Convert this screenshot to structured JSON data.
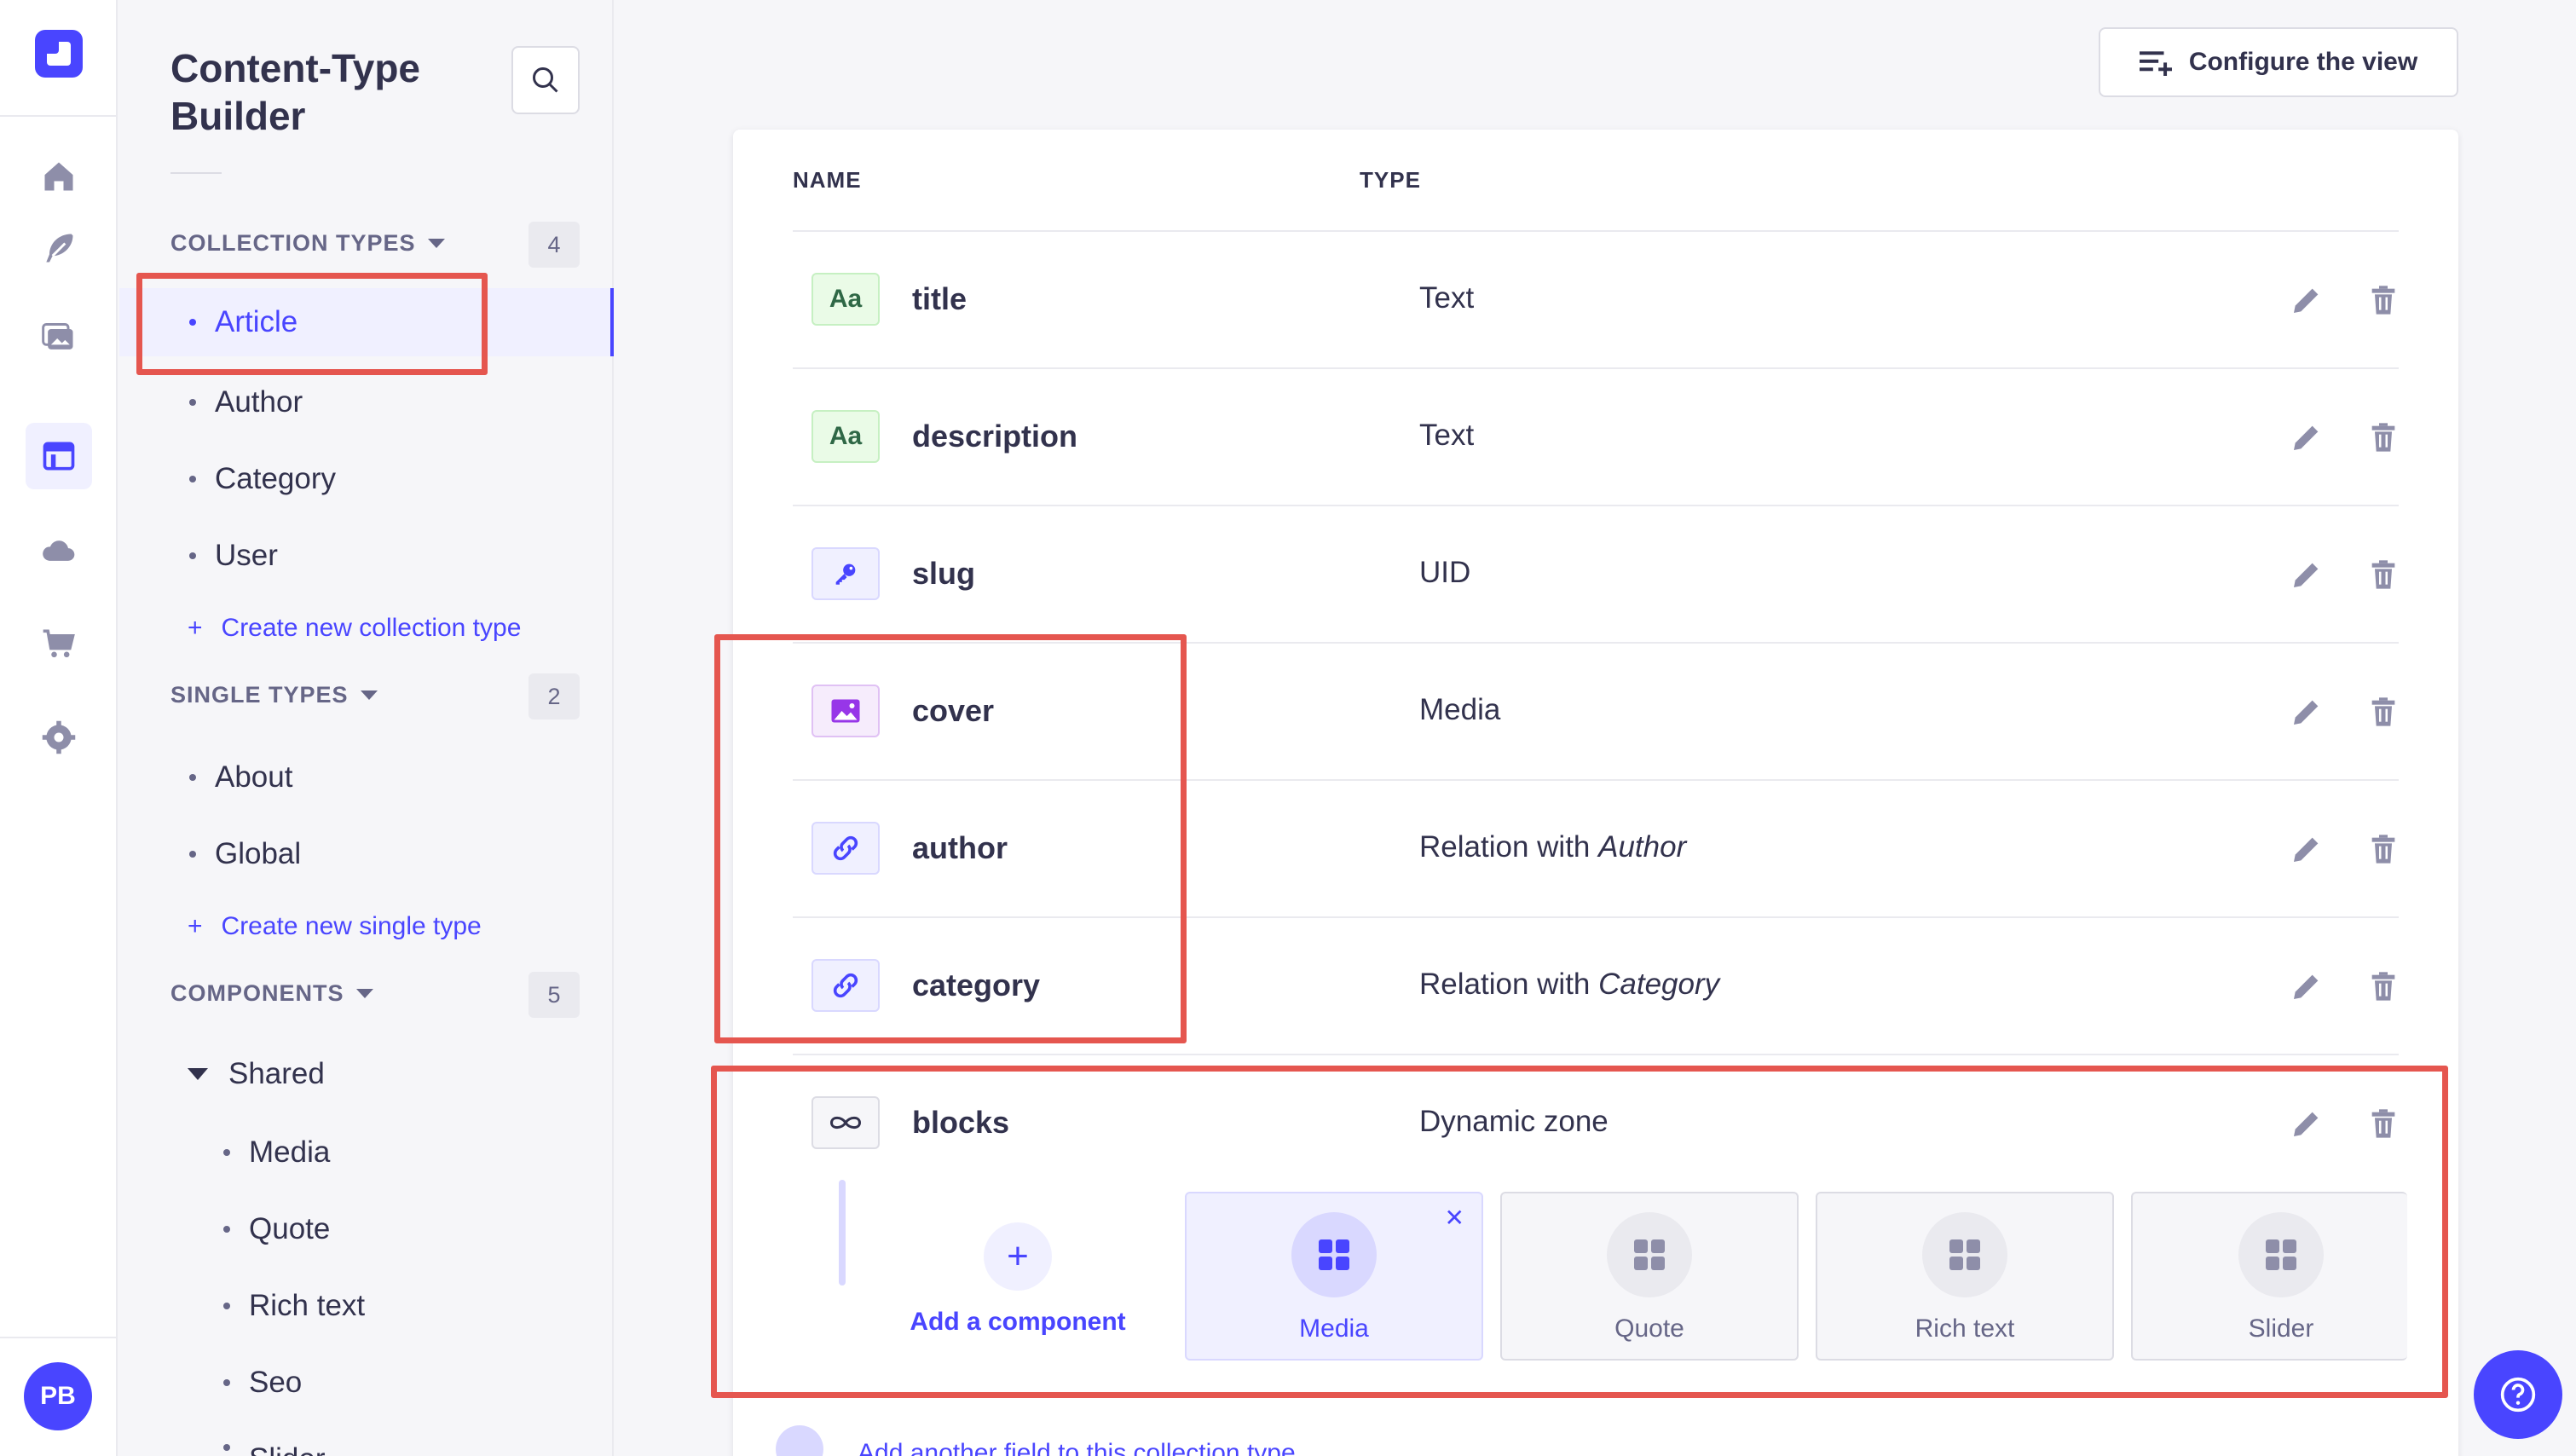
{
  "app": {
    "avatar_initials": "PB"
  },
  "subnav": {
    "title": "Content-Type Builder",
    "collection_types": {
      "label": "COLLECTION TYPES",
      "count": "4",
      "items": [
        "Article",
        "Author",
        "Category",
        "User"
      ],
      "active": "Article",
      "create_label": "Create new collection type"
    },
    "single_types": {
      "label": "SINGLE TYPES",
      "count": "2",
      "items": [
        "About",
        "Global"
      ],
      "create_label": "Create new single type"
    },
    "components": {
      "label": "COMPONENTS",
      "count": "5",
      "group": "Shared",
      "items": [
        "Media",
        "Quote",
        "Rich text",
        "Seo",
        "Slider"
      ]
    }
  },
  "toolbar": {
    "configure_label": "Configure the view"
  },
  "table": {
    "headers": {
      "name": "NAME",
      "type": "TYPE"
    },
    "rows": [
      {
        "icon": "text-icon",
        "icon_label": "Aa",
        "name": "title",
        "type": "Text"
      },
      {
        "icon": "text-icon",
        "icon_label": "Aa",
        "name": "description",
        "type": "Text"
      },
      {
        "icon": "key-icon",
        "name": "slug",
        "type": "UID"
      },
      {
        "icon": "image-icon",
        "name": "cover",
        "type": "Media"
      },
      {
        "icon": "link-icon",
        "name": "author",
        "type_prefix": "Relation with ",
        "type_target": "Author"
      },
      {
        "icon": "link-icon",
        "name": "category",
        "type_prefix": "Relation with ",
        "type_target": "Category"
      },
      {
        "icon": "infinity-icon",
        "name": "blocks",
        "type": "Dynamic zone"
      }
    ]
  },
  "dynamic_zone": {
    "add_label": "Add a component",
    "components": [
      "Media",
      "Quote",
      "Rich text",
      "Slider"
    ],
    "selected": "Media"
  },
  "footer": {
    "add_another_label": "Add another field to this collection type"
  },
  "colors": {
    "primary": "#4945ff",
    "highlight": "#e5564f"
  }
}
